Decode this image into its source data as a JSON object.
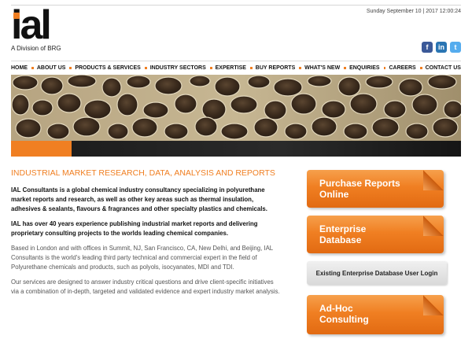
{
  "header": {
    "logo_text": "ial",
    "logo_subtitle": "A Division of BRG",
    "datetime": "Sunday September 10 | 2017 12:00:24",
    "social": [
      {
        "name": "facebook-icon",
        "glyph": "f"
      },
      {
        "name": "linkedin-icon",
        "glyph": "in"
      },
      {
        "name": "twitter-icon",
        "glyph": "t"
      }
    ]
  },
  "nav": {
    "items": [
      "HOME",
      "ABOUT US",
      "PRODUCTS & SERVICES",
      "INDUSTRY SECTORS",
      "EXPERTISE",
      "BUY REPORTS",
      "WHAT'S NEW",
      "ENQUIRIES",
      "CAREERS",
      "CONTACT US"
    ]
  },
  "main": {
    "heading": "INDUSTRIAL MARKET RESEARCH, DATA, ANALYSIS AND REPORTS",
    "para1": "IAL Consultants is a global chemical industry consultancy specializing in polyurethane market reports and research, as well as other key areas such as thermal insulation, adhesives & sealants, flavours & fragrances and other specialty plastics and chemicals.",
    "para2": "IAL has over 40 years experience publishing industrial market reports and delivering proprietary consulting projects to the worlds leading chemical companies.",
    "para3": "Based in London and with offices in Summit, NJ, San Francisco, CA, New Delhi, and Beijing, IAL Consultants is the world's leading third party technical and commercial expert in the field of Polyurethane chemicals and products, such as polyols, isocyanates, MDI and TDI.",
    "para4": "Our services are designed to answer industry critical questions and drive client-specific initiatives via a combination of in-depth, targeted and validated evidence and expert industry market analysis."
  },
  "side": {
    "purchase_line1": "Purchase Reports",
    "purchase_line2": "Online",
    "enterprise_line1": "Enterprise",
    "enterprise_line2": "Database",
    "existing_login": "Existing Enterprise Database User Login",
    "adhoc_line1": "Ad-Hoc",
    "adhoc_line2": "Consulting"
  },
  "colors": {
    "accent": "#f07f22",
    "heading": "#f07f22"
  }
}
